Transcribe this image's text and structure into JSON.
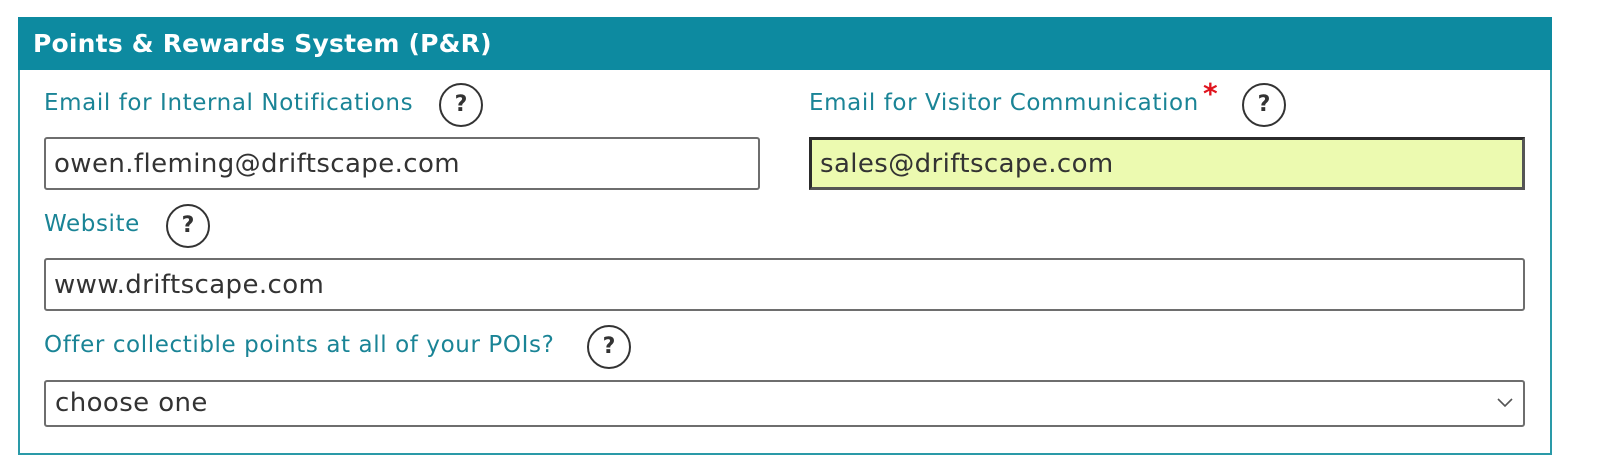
{
  "panel": {
    "title": "Points & Rewards System (P&R)",
    "header_color": "#0d8aa0",
    "label_color": "#1a8496",
    "required_color": "#e0141e",
    "highlight_color": "#ecfab0"
  },
  "fields": {
    "internal_email": {
      "label": "Email for Internal Notifications",
      "value": "owen.fleming@driftscape.com",
      "help": "?"
    },
    "visitor_email": {
      "label": "Email for Visitor Communication",
      "required_mark": "*",
      "value": "sales@driftscape.com",
      "help": "?"
    },
    "website": {
      "label": "Website",
      "value": "www.driftscape.com",
      "help": "?"
    },
    "collectible_points": {
      "label": "Offer collectible points at all of your POIs?",
      "selected": "choose one",
      "help": "?"
    }
  },
  "icons": {
    "help": "question-circle-icon",
    "dropdown": "chevron-down-icon"
  }
}
